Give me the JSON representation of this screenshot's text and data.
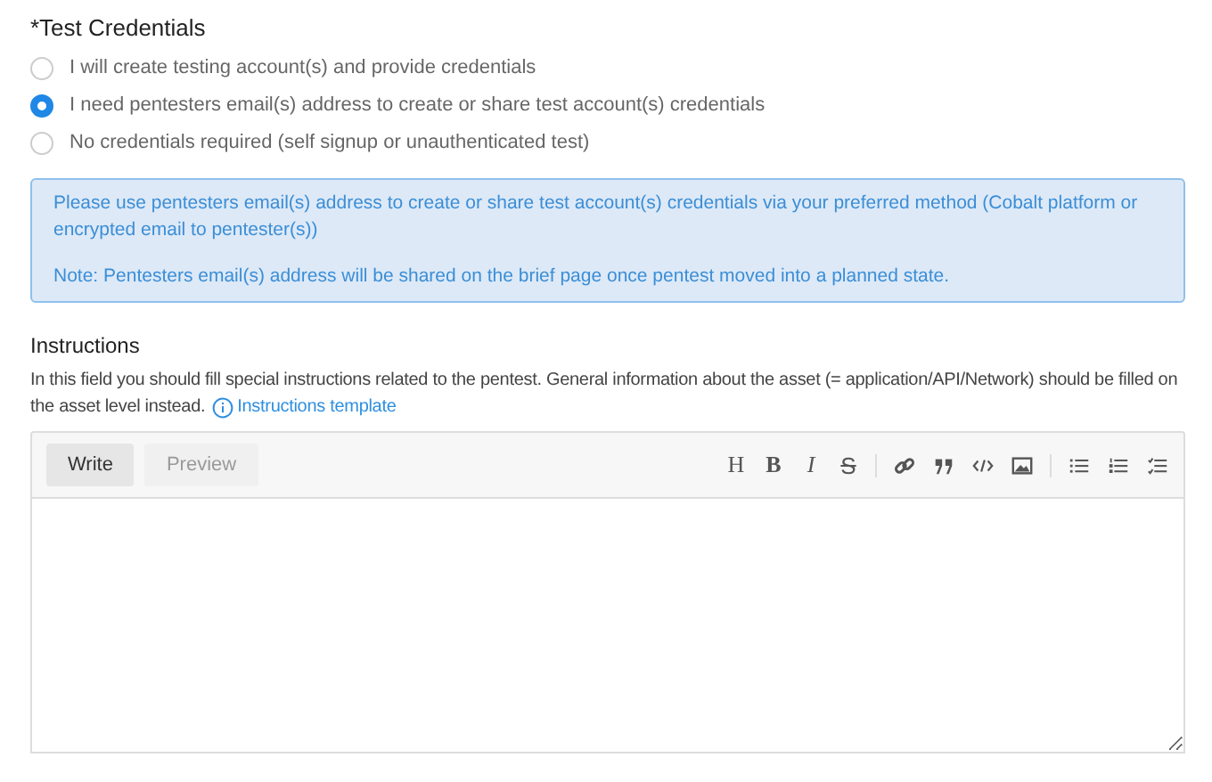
{
  "credentials": {
    "title": "*Test Credentials",
    "options": [
      {
        "label": "I will create testing account(s) and provide credentials",
        "selected": false
      },
      {
        "label": "I need pentesters email(s) address to create or share test account(s) credentials",
        "selected": true
      },
      {
        "label": "No credentials required (self signup or unauthenticated test)",
        "selected": false
      }
    ],
    "info": [
      "Please use pentesters email(s) address to create or share test account(s) credentials via your preferred method (Cobalt platform or encrypted email to pentester(s))",
      "Note: Pentesters email(s) address will be shared on the brief page once pentest moved into a planned state."
    ]
  },
  "instructions": {
    "title": "Instructions",
    "description": [
      "In this field you should fill special instructions related to the pentest. General information about the asset (= application/API/Network) should be filled on",
      "the asset level instead."
    ],
    "link": "Instructions template",
    "editor": {
      "tabs": [
        {
          "label": "Write",
          "selected": true
        },
        {
          "label": "Preview",
          "selected": false
        }
      ],
      "toolbar": [
        {
          "kind": "heading",
          "label": "H"
        },
        {
          "kind": "bold",
          "label": "B"
        },
        {
          "kind": "italic",
          "label": "I"
        },
        {
          "kind": "strike",
          "label": "S"
        },
        {
          "kind": "sep"
        },
        {
          "kind": "link"
        },
        {
          "kind": "quote"
        },
        {
          "kind": "code"
        },
        {
          "kind": "image"
        },
        {
          "kind": "sep"
        },
        {
          "kind": "bullets"
        },
        {
          "kind": "numbers"
        },
        {
          "kind": "tasks"
        }
      ]
    }
  }
}
